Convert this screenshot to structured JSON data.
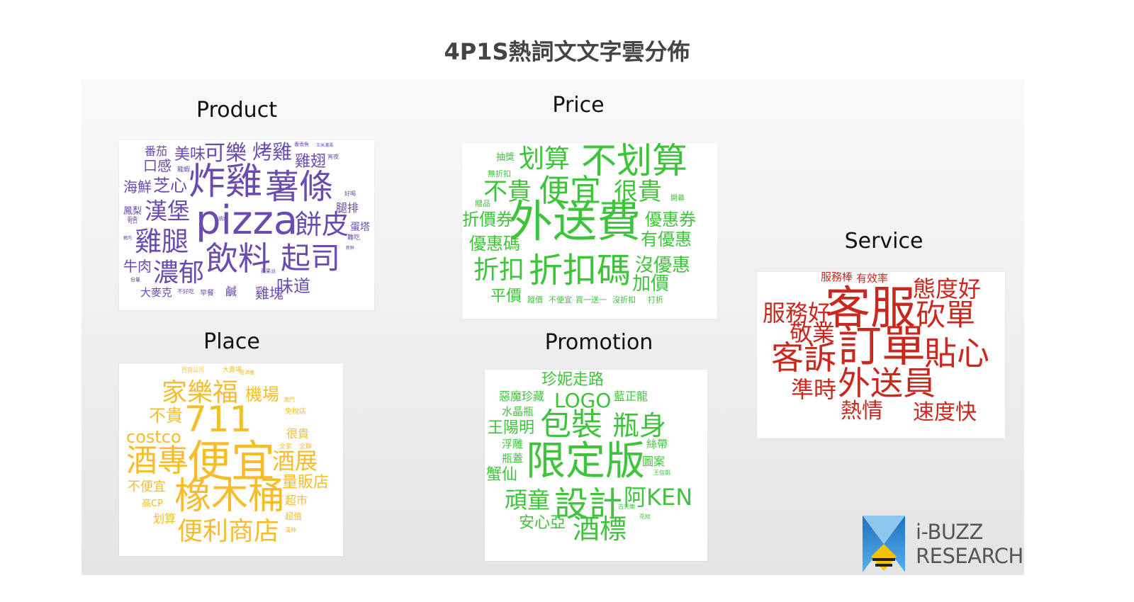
{
  "title": "4P1S熱詞文文字雲分佈",
  "colors": {
    "product": "#6a4bb0",
    "price": "#3ec43a",
    "place": "#f5bd2c",
    "promotion": "#3ec43a",
    "service": "#c8281e"
  },
  "clouds": {
    "product": {
      "label": "Product",
      "words": [
        "番茄",
        "美味",
        "可樂",
        "烤雞",
        "番香魚",
        "玉米濃湯",
        "口感",
        "龍蝦",
        "雞翅",
        "宵夜",
        "海鮮",
        "芝心",
        "炸雞",
        "薯條",
        "好喝",
        "鳳梨",
        "奶茶",
        "燒肉",
        "腿排",
        "漢堡",
        "pizza",
        "餅皮",
        "蛋塔",
        "可口",
        "難吃",
        "雞腿",
        "飲料",
        "起司",
        "豬肉",
        "新鮮",
        "牛肉",
        "濃郁",
        "蘋果派",
        "份量",
        "大麥克",
        "不好吃",
        "早餐",
        "鹹",
        "雞塊",
        "味道"
      ]
    },
    "price": {
      "label": "Price",
      "words": [
        "抽獎",
        "划算",
        "不划算",
        "無折扣",
        "不貴",
        "便宜",
        "很貴",
        "開幕",
        "贈品",
        "折價券",
        "外送費",
        "優惠券",
        "優惠碼",
        "有優惠",
        "折扣",
        "折扣碼",
        "沒優惠",
        "加價",
        "平價",
        "蹤價",
        "不便宜",
        "買一送一",
        "沒折扣",
        "打折"
      ]
    },
    "place": {
      "label": "Place",
      "words": [
        "百貨公司",
        "大賣場",
        "經濟艙",
        "家樂福",
        "機場",
        "澳門",
        "不貴",
        "711",
        "免稅店",
        "costco",
        "很貴",
        "全家",
        "全聯",
        "酒專",
        "便宜",
        "酒展",
        "不便宜",
        "量販店",
        "高CP",
        "橡木桶",
        "超市",
        "划算",
        "超值",
        "便利商店",
        "漢神"
      ]
    },
    "promotion": {
      "label": "Promotion",
      "words": [
        "珍妮走路",
        "惡魔珍藏",
        "LOGO",
        "藍正龍",
        "水晶瓶",
        "王陽明",
        "包裝",
        "瓶身",
        "浮雕",
        "絲帶",
        "瓶蓋",
        "限定版",
        "圖案",
        "王信凱",
        "蟹仙",
        "頑童",
        "設計",
        "阿KEN",
        "古天樂",
        "安心亞",
        "酒標",
        "花紋"
      ]
    },
    "service": {
      "label": "Service",
      "words": [
        "服務棒",
        "有效率",
        "態度好",
        "服務好",
        "客服",
        "砍單",
        "敬業",
        "客訴",
        "訂單",
        "貼心",
        "準時",
        "外送員",
        "熱情",
        "速度快"
      ]
    }
  },
  "logo": {
    "line1": "i-BUZZ",
    "line2": "RESEARCH"
  }
}
